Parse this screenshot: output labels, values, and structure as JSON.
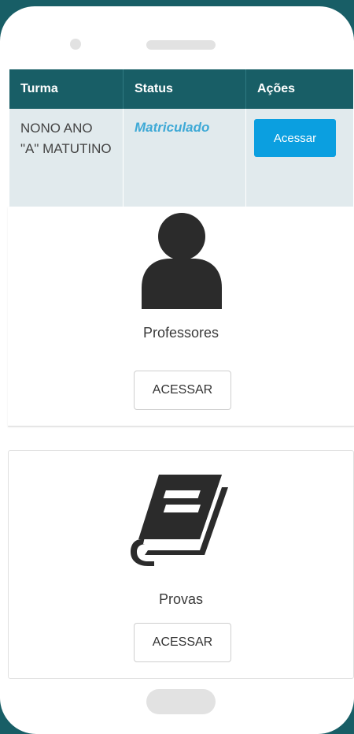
{
  "table": {
    "headers": [
      "Turma",
      "Status",
      "Ações"
    ],
    "row": {
      "turma": "NONO ANO \"A\" MATUTINO",
      "status": "Matriculado",
      "action_label": "Acessar"
    }
  },
  "cards": {
    "professores": {
      "label": "Professores",
      "button": "ACESSAR",
      "icon": "person-icon"
    },
    "provas": {
      "label": "Provas",
      "button": "ACESSAR",
      "icon": "book-icon"
    }
  },
  "colors": {
    "header": "#185e66",
    "status": "#3ea9d6",
    "primary_button": "#0b9fe0",
    "row_bg": "#e1eaed"
  }
}
